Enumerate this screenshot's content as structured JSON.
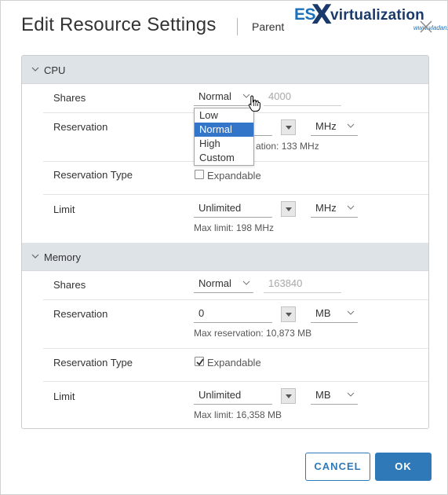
{
  "dialog": {
    "title": "Edit Resource Settings",
    "subtitle": "Parent",
    "close_icon": "close-icon"
  },
  "watermark": {
    "es": "ES",
    "x": "X",
    "virtualization": "virtualization",
    "site": "www.vladan.fr"
  },
  "cpu": {
    "section_label": "CPU",
    "shares": {
      "label": "Shares",
      "level": "Normal",
      "value": "4000",
      "dropdown_open": true,
      "options": [
        "Low",
        "Normal",
        "High",
        "Custom"
      ],
      "selected_option": "Normal"
    },
    "reservation": {
      "label": "Reservation",
      "value": "",
      "unit": "MHz",
      "hint": "Max reservation: 133 MHz",
      "hint_visible_part": "ation: 133 MHz"
    },
    "reservation_type": {
      "label": "Reservation Type",
      "option_label": "Expandable",
      "checked": false
    },
    "limit": {
      "label": "Limit",
      "value": "Unlimited",
      "unit": "MHz",
      "hint": "Max limit: 198 MHz"
    }
  },
  "memory": {
    "section_label": "Memory",
    "shares": {
      "label": "Shares",
      "level": "Normal",
      "value": "163840"
    },
    "reservation": {
      "label": "Reservation",
      "value": "0",
      "unit": "MB",
      "hint": "Max reservation: 10,873 MB"
    },
    "reservation_type": {
      "label": "Reservation Type",
      "option_label": "Expandable",
      "checked": true
    },
    "limit": {
      "label": "Limit",
      "value": "Unlimited",
      "unit": "MB",
      "hint": "Max limit: 16,358 MB"
    }
  },
  "footer": {
    "cancel_label": "CANCEL",
    "ok_label": "OK"
  },
  "colors": {
    "accent": "#2f79b9",
    "section_header_bg": "#dee3e8",
    "selected_option_bg": "#3375c8"
  }
}
